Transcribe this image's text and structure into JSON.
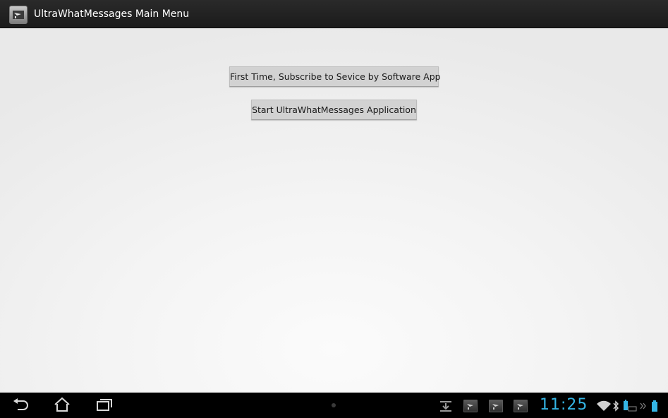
{
  "titlebar": {
    "title": "UltraWhatMessages Main Menu",
    "icon": "app-icon"
  },
  "main": {
    "buttons": [
      {
        "label": "First Time, Subscribe to Sevice by Software App"
      },
      {
        "label": "Start UltraWhatMessages Application"
      }
    ]
  },
  "system_bar": {
    "nav": {
      "back_icon": "back-arrow-icon",
      "home_icon": "home-icon",
      "recents_icon": "recent-apps-icon"
    },
    "notifications": [
      "download-icon",
      "app-notification-icon",
      "app-notification-icon",
      "app-notification-icon"
    ],
    "clock": "11:25",
    "status_icons": [
      "wifi-icon",
      "bluetooth-icon",
      "keyboard-battery-icon",
      "chevron-icon",
      "battery-icon"
    ],
    "accent_color": "#34b5e5"
  }
}
